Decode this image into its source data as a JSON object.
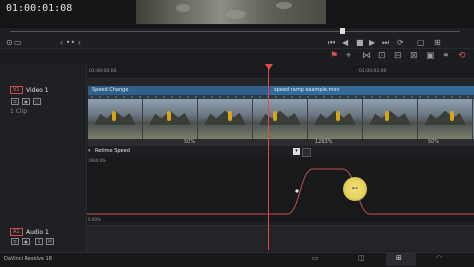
{
  "viewer": {
    "time_placeholder": ""
  },
  "timeline": {
    "timecode": "01:00:01:08",
    "ruler": [
      "01:00:00:00",
      "01:00:02:00"
    ],
    "video_track": {
      "id": "V1",
      "name": "Video 1",
      "sub": "1 Clip"
    },
    "audio_track": {
      "id": "A1",
      "name": "Audio 1",
      "value": "2.0"
    },
    "clip": {
      "speed_label": "Speed Change",
      "file_name": "speed ramp example.mov"
    },
    "percent_labels": [
      "50%",
      "1263%",
      "50%"
    ],
    "retime": {
      "title": "Retime Speed",
      "y_top": "1900.0%",
      "y_bottom": "0.00%"
    }
  },
  "app": {
    "name": "DaVinci Resolve 18"
  },
  "colors": {
    "playhead": "#e04848",
    "clip": "#2f5f8a",
    "curve": "#c05050",
    "highlight": "#e6d35c"
  },
  "icons": [
    "play-icon",
    "stop-icon",
    "prev-icon",
    "next-icon",
    "loop-icon",
    "blade-icon",
    "link-icon",
    "snap-icon",
    "flag-icon",
    "marker-icon"
  ]
}
